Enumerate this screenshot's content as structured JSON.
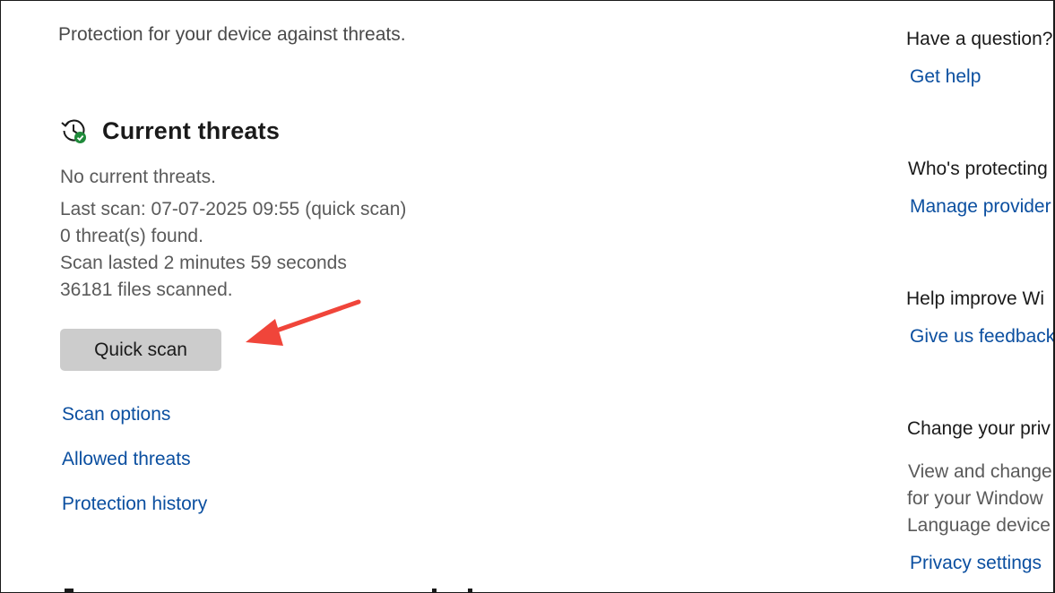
{
  "main": {
    "subtitle": "Protection for your device against threats.",
    "section_title": "Current threats",
    "status": "No current threats.",
    "last_scan": "Last scan: 07-07-2025 09:55 (quick scan)",
    "threats_found": "0 threat(s) found.",
    "scan_duration": "Scan lasted 2 minutes 59 seconds",
    "files_scanned": "36181 files scanned.",
    "quick_scan_label": "Quick scan",
    "links": {
      "scan_options": "Scan options",
      "allowed_threats": "Allowed threats",
      "protection_history": "Protection history"
    }
  },
  "sidebar": {
    "question_title": "Have a question?",
    "get_help": "Get help",
    "protecting_title": "Who's protecting",
    "manage_providers": "Manage provider",
    "improve_title": "Help improve Wi",
    "feedback": "Give us feedback",
    "privacy_title": "Change your priv",
    "privacy_desc_1": "View and change",
    "privacy_desc_2": "for your Window",
    "privacy_desc_3": "Language device",
    "privacy_settings": "Privacy settings"
  },
  "colors": {
    "link": "#0b4fa0",
    "annotation_arrow": "#f0453a",
    "button_bg": "#cccccc",
    "check_badge": "#1f8a3a"
  },
  "icons": {
    "section_icon": "history-clock-check-icon"
  }
}
